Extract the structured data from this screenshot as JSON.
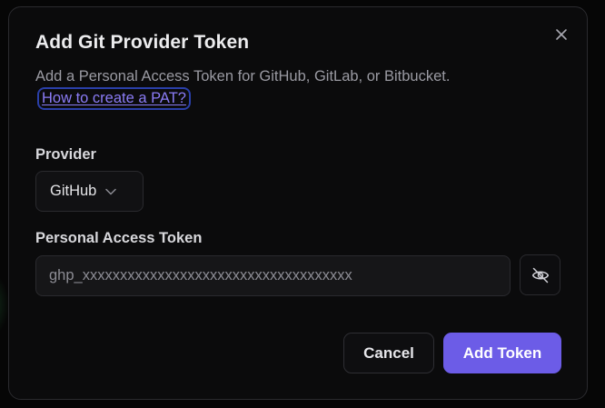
{
  "dialog": {
    "title": "Add Git Provider Token",
    "description": "Add a Personal Access Token for GitHub, GitLab, or Bitbucket.",
    "help_link": "How to create a PAT?",
    "close_icon": "close-icon"
  },
  "provider": {
    "label": "Provider",
    "selected": "GitHub",
    "icon": "chevron-down-icon"
  },
  "token": {
    "label": "Personal Access Token",
    "placeholder": "ghp_xxxxxxxxxxxxxxxxxxxxxxxxxxxxxxxxxxxx",
    "value": "",
    "visibility_icon": "eye-off-icon"
  },
  "actions": {
    "cancel_label": "Cancel",
    "submit_label": "Add Token"
  },
  "colors": {
    "accent": "#6c5ce7",
    "link": "#8b7cf6",
    "background": "#0b0b0c"
  }
}
